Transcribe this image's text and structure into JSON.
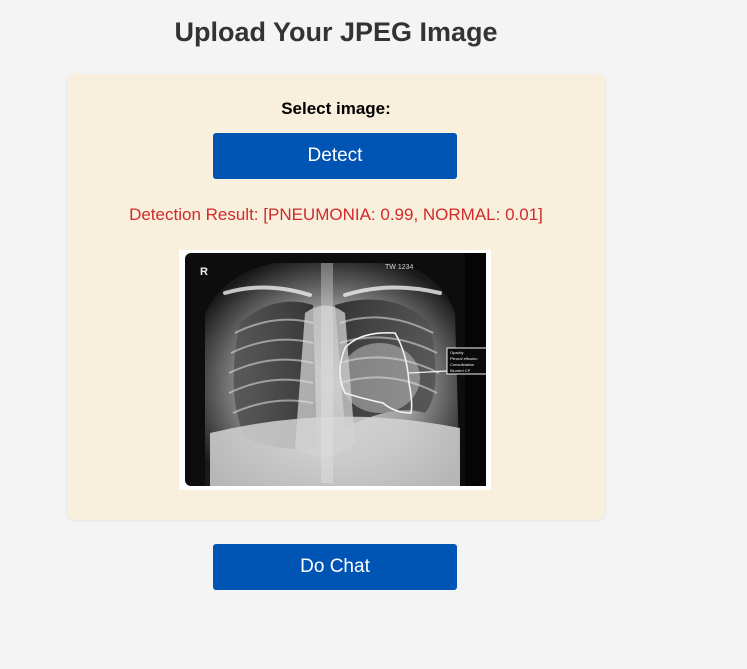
{
  "page": {
    "title": "Upload Your JPEG Image"
  },
  "upload_card": {
    "select_label": "Select image:",
    "detect_button_label": "Detect",
    "result_text": "Detection Result: [PNEUMONIA: 0.99, NORMAL: 0.01]",
    "image": {
      "side_marker": "R",
      "corner_text": "TW 1234",
      "annotation_lines": [
        "Opacity",
        "Pleural effusion",
        "Consolidation",
        "Blunted CP"
      ]
    }
  },
  "chat_button_label": "Do Chat",
  "colors": {
    "background": "#f4f4f5",
    "card": "#f8f0dc",
    "button": "#0054b4",
    "result_text": "#d12a2a"
  }
}
